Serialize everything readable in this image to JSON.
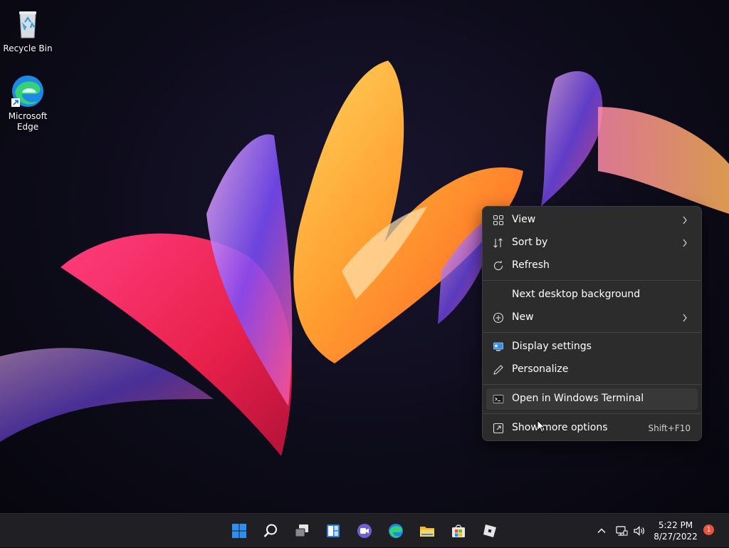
{
  "desktop": {
    "icons": [
      {
        "label": "Recycle Bin",
        "icon": "recycle-bin-icon"
      },
      {
        "label": "Microsoft Edge",
        "icon": "edge-icon"
      }
    ]
  },
  "context_menu": {
    "items": [
      {
        "label": "View",
        "icon": "grid-view-icon",
        "submenu": true
      },
      {
        "label": "Sort by",
        "icon": "sort-icon",
        "submenu": true
      },
      {
        "label": "Refresh",
        "icon": "refresh-icon",
        "submenu": false
      },
      {
        "label": "Next desktop background",
        "icon": "",
        "submenu": false
      },
      {
        "label": "New",
        "icon": "plus-circle-icon",
        "submenu": true
      },
      {
        "label": "Display settings",
        "icon": "display-settings-icon",
        "submenu": false
      },
      {
        "label": "Personalize",
        "icon": "pen-icon",
        "submenu": false
      },
      {
        "label": "Open in Windows Terminal",
        "icon": "terminal-icon",
        "submenu": false
      },
      {
        "label": "Show more options",
        "icon": "more-options-icon",
        "shortcut": "Shift+F10"
      }
    ]
  },
  "taskbar": {
    "apps": [
      "start-icon",
      "search-icon",
      "task-view-icon",
      "widgets-icon",
      "chat-icon",
      "edge-icon",
      "file-explorer-icon",
      "store-icon",
      "roblox-icon"
    ],
    "tray": {
      "icons": [
        "chevron-up-icon",
        "network-icon",
        "volume-icon"
      ],
      "time": "5:22 PM",
      "date": "8/27/2022",
      "notification_count": "1"
    }
  },
  "colors": {
    "menu_bg": "#2c2c2c",
    "taskbar_bg": "#1f1f24",
    "accent_blue": "#2f8ff0",
    "badge_red": "#e8543c"
  }
}
